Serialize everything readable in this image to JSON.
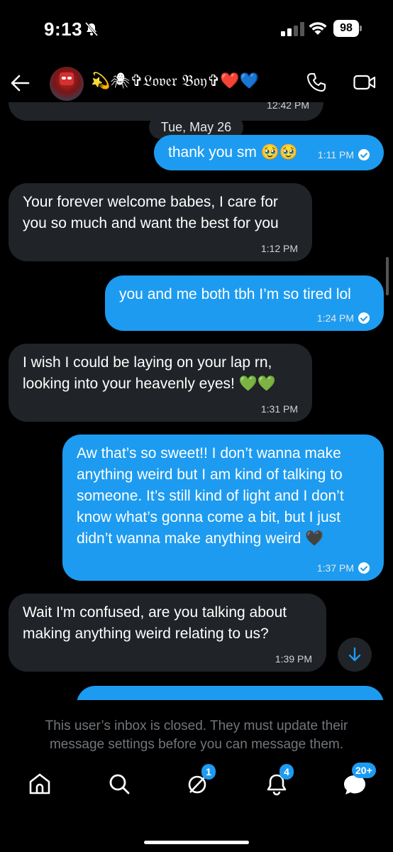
{
  "status_bar": {
    "time": "9:13",
    "battery": "98"
  },
  "header": {
    "contact_name": "💫🕷✞𝔏𝔬𝔳𝔢𝔯 𝔅𝔬𝔶✞❤️💙"
  },
  "conversation": {
    "previous_time": "12:42 PM",
    "date_label": "Tue, May 26",
    "messages": [
      {
        "direction": "sent",
        "text": "thank you sm 🥹🥹",
        "time": "1:11 PM"
      },
      {
        "direction": "received",
        "text": "Your forever welcome babes, I care for you so much and want the best for you",
        "time": "1:12 PM"
      },
      {
        "direction": "sent",
        "text": "you and me both tbh I’m so tired lol",
        "time": "1:24 PM"
      },
      {
        "direction": "received",
        "text": "I wish I could be laying on your lap rn, looking into your heavenly eyes! 💚💚",
        "time": "1:31 PM"
      },
      {
        "direction": "sent",
        "text": "Aw that’s so sweet!! I don’t wanna make anything weird but I am kind of talking to someone. It’s still kind of light and I don’t know what’s gonna come a bit, but I just didn’t wanna make anything weird 🖤",
        "time": "1:37 PM"
      },
      {
        "direction": "received",
        "text": "Wait I'm confused, are you talking about making anything weird relating to us?",
        "time": "1:39 PM"
      }
    ]
  },
  "footer": {
    "closed_notice": "This user’s inbox is closed. They must update their message settings before you can message them."
  },
  "tabbar": {
    "grok_badge": "1",
    "notifications_badge": "4",
    "messages_badge": "20+"
  },
  "colors": {
    "accent": "#1d9bf0",
    "received_bubble": "#202327",
    "muted_text": "#71767b"
  }
}
